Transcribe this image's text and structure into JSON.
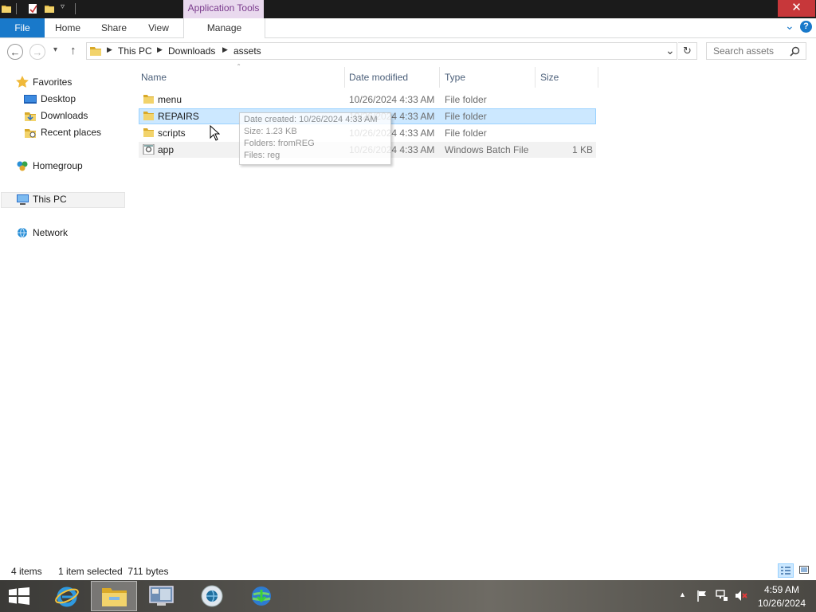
{
  "titlebar": {
    "context_tab": "Application Tools",
    "close_glyph": "✕"
  },
  "ribbon": {
    "file": "File",
    "tabs": [
      "Home",
      "Share",
      "View"
    ],
    "manage": "Manage",
    "expand_glyph": "⌄",
    "help_glyph": "?"
  },
  "nav": {
    "back_glyph": "←",
    "forward_glyph": "→",
    "recent_glyph": "▾",
    "up_glyph": "↑",
    "breadcrumb": [
      "This PC",
      "Downloads",
      "assets"
    ],
    "dropdown_glyph": "⌄",
    "refresh_glyph": "↻",
    "search_placeholder": "Search assets"
  },
  "sidebar": {
    "favorites": "Favorites",
    "desktop": "Desktop",
    "downloads": "Downloads",
    "recent_places": "Recent places",
    "homegroup": "Homegroup",
    "this_pc": "This PC",
    "network": "Network"
  },
  "columns": {
    "name": "Name",
    "date": "Date modified",
    "type": "Type",
    "size": "Size",
    "sort_glyph": "ˆ"
  },
  "files": [
    {
      "name": "menu",
      "date": "10/26/2024 4:33 AM",
      "type": "File folder",
      "size": "",
      "icon": "folder-icon"
    },
    {
      "name": "REPAIRS",
      "date": "10/26/2024 4:33 AM",
      "type": "File folder",
      "size": "",
      "icon": "folder-icon"
    },
    {
      "name": "scripts",
      "date": "10/26/2024 4:33 AM",
      "type": "File folder",
      "size": "",
      "icon": "folder-icon"
    },
    {
      "name": "app",
      "date": "10/26/2024 4:33 AM",
      "type": "Windows Batch File",
      "size": "1 KB",
      "icon": "batch-file-icon"
    }
  ],
  "tooltip": {
    "created": "Date created: 10/26/2024 4:33 AM",
    "size": "Size: 1.23 KB",
    "folders": "Folders: fromREG",
    "files": "Files: reg"
  },
  "status": {
    "items": "4 items",
    "selected": "1 item selected  711 bytes"
  },
  "taskbar": {
    "time": "4:59 AM",
    "date": "10/26/2024",
    "tray_arrow": "▲"
  },
  "colors": {
    "accent": "#1979ca",
    "selection": "#cce8ff",
    "close": "#c7373a",
    "context_tab": "#e9d9ee"
  }
}
